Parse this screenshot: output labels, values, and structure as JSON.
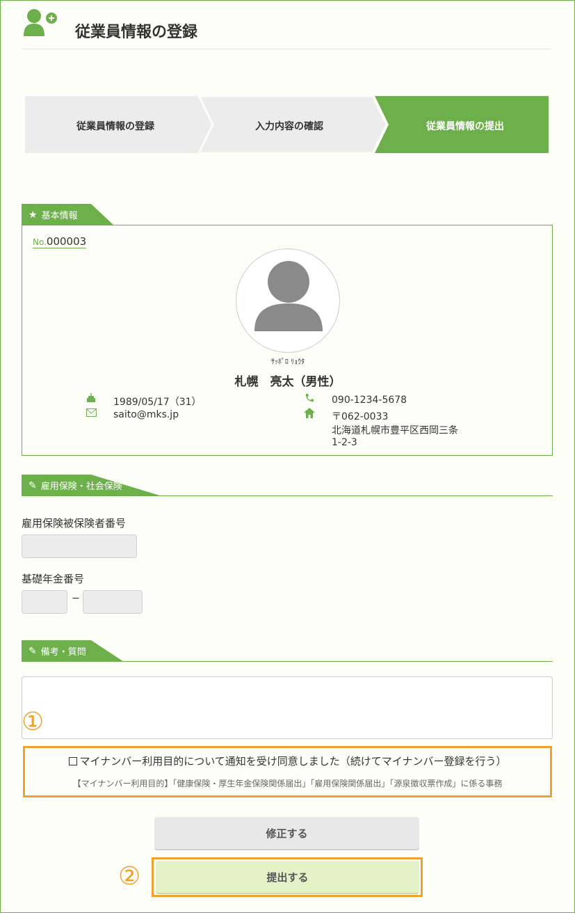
{
  "page": {
    "title": "従業員情報の登録"
  },
  "steps": [
    {
      "label": "従業員情報の登録"
    },
    {
      "label": "入力内容の確認"
    },
    {
      "label": "従業員情報の提出"
    }
  ],
  "basic": {
    "section_title": "基本情報",
    "no_prefix": "No.",
    "no": "000003",
    "kana": "ｻｯﾎﾟﾛ ﾘｮｳﾀ",
    "name": "札幌　亮太（男性）",
    "birthday": "1989/05/17（31）",
    "email": "saito@mks.jp",
    "phone": "090-1234-5678",
    "postal": "〒062-0033",
    "address1": "北海道札幌市豊平区西岡三条",
    "address2": "1-2-3"
  },
  "insurance": {
    "section_title": "雇用保険・社会保険",
    "employment_label": "雇用保険被保険者番号",
    "employment_value": "",
    "pension_label": "基礎年金番号",
    "pension_value1": "",
    "pension_value2": "",
    "dash": "−"
  },
  "remarks": {
    "section_title": "備考・質問",
    "value": ""
  },
  "markers": {
    "one": "①",
    "two": "②"
  },
  "consent": {
    "label": "マイナンバー利用目的について通知を受け同意しました（続けてマイナンバー登録を行う）",
    "purpose": "【マイナンバー利用目的】「健康保険・厚生年金保険関係届出」「雇用保険関係届出」「源泉徴収票作成」に係る事務"
  },
  "buttons": {
    "fix": "修正する",
    "submit": "提出する"
  },
  "colors": {
    "accent": "#6db04b",
    "highlight": "#f0a030",
    "step_inactive": "#ececec"
  }
}
